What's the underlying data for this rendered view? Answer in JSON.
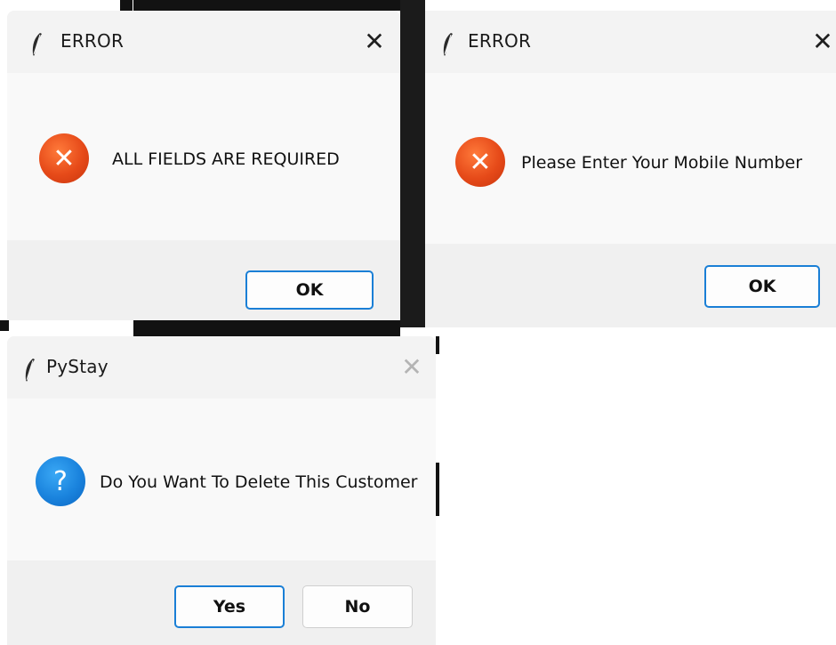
{
  "dialogs": [
    {
      "title": "ERROR",
      "close_glyph": "✕",
      "icon": "error-icon",
      "icon_glyph": "✕",
      "message": "ALL FIELDS ARE REQUIRED",
      "buttons": [
        {
          "label": "OK",
          "default": true
        }
      ]
    },
    {
      "title": "ERROR",
      "close_glyph": "✕",
      "icon": "error-icon",
      "icon_glyph": "✕",
      "message": "Please Enter Your Mobile Number",
      "buttons": [
        {
          "label": "OK",
          "default": true
        }
      ]
    },
    {
      "title": "PyStay",
      "close_glyph": "✕",
      "close_enabled": false,
      "icon": "question-icon",
      "icon_glyph": "?",
      "message": "Do You Want To Delete This Customer",
      "buttons": [
        {
          "label": "Yes",
          "default": true
        },
        {
          "label": "No",
          "default": false
        }
      ]
    }
  ],
  "colors": {
    "error_icon": "#e64a19",
    "question_icon": "#1a83dd",
    "default_button_border": "#1a7fd6",
    "footer": "#f0f0f0",
    "content": "#f9f9f9"
  }
}
